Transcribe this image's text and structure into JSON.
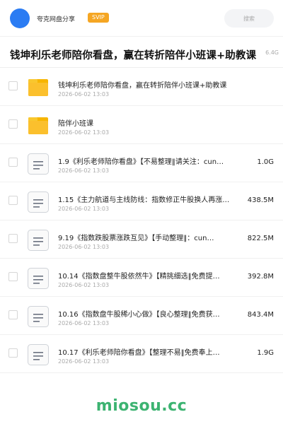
{
  "header": {
    "site_name": "夸克网盘分享",
    "badge": "SVIP",
    "search_placeholder": "搜索"
  },
  "folder": {
    "title": "钱坤利乐老师陪你看盘，赢在转折陪伴小班课+助教课",
    "size": "6.4G"
  },
  "files": [
    {
      "icon": "folder-icon",
      "name": "钱坤利乐老师陪你看盘，赢在转折陪伴小班课+助教课",
      "date": "2026-06-02 13:03",
      "size": ""
    },
    {
      "icon": "folder-icon",
      "name": "陪伴小班课",
      "date": "2026-06-02 13:03",
      "size": ""
    },
    {
      "icon": "document-icon",
      "name": "1.9《利乐老师陪你看盘》【不易整理‖请关注：cun…",
      "date": "2026-06-02 13:03",
      "size": "1.0G"
    },
    {
      "icon": "document-icon",
      "name": "1.15《主力航道与主线防线：指数修正牛股换人再涨…",
      "date": "2026-06-02 13:03",
      "size": "438.5M"
    },
    {
      "icon": "document-icon",
      "name": "9.19《指数跌股票涨跌互见》【手动整理‖：cun…",
      "date": "2026-06-02 13:03",
      "size": "822.5M"
    },
    {
      "icon": "document-icon",
      "name": "10.14《指数盘整牛股依然牛》【精挑细选‖免费提…",
      "date": "2026-06-02 13:03",
      "size": "392.8M"
    },
    {
      "icon": "document-icon",
      "name": "10.16《指数盘牛股稀小心做》【良心整理‖免费获…",
      "date": "2026-06-02 13:03",
      "size": "843.4M"
    },
    {
      "icon": "document-icon",
      "name": "10.17《利乐老师陪你看盘》【整理不易‖免费奉上…",
      "date": "2026-06-02 13:03",
      "size": "1.9G"
    }
  ],
  "watermark": "miosou.cc",
  "colors": {
    "avatar": "#2b7cf3",
    "badge": "#f5a623",
    "folder": "#fbc02d",
    "watermark": "#3cb371"
  }
}
